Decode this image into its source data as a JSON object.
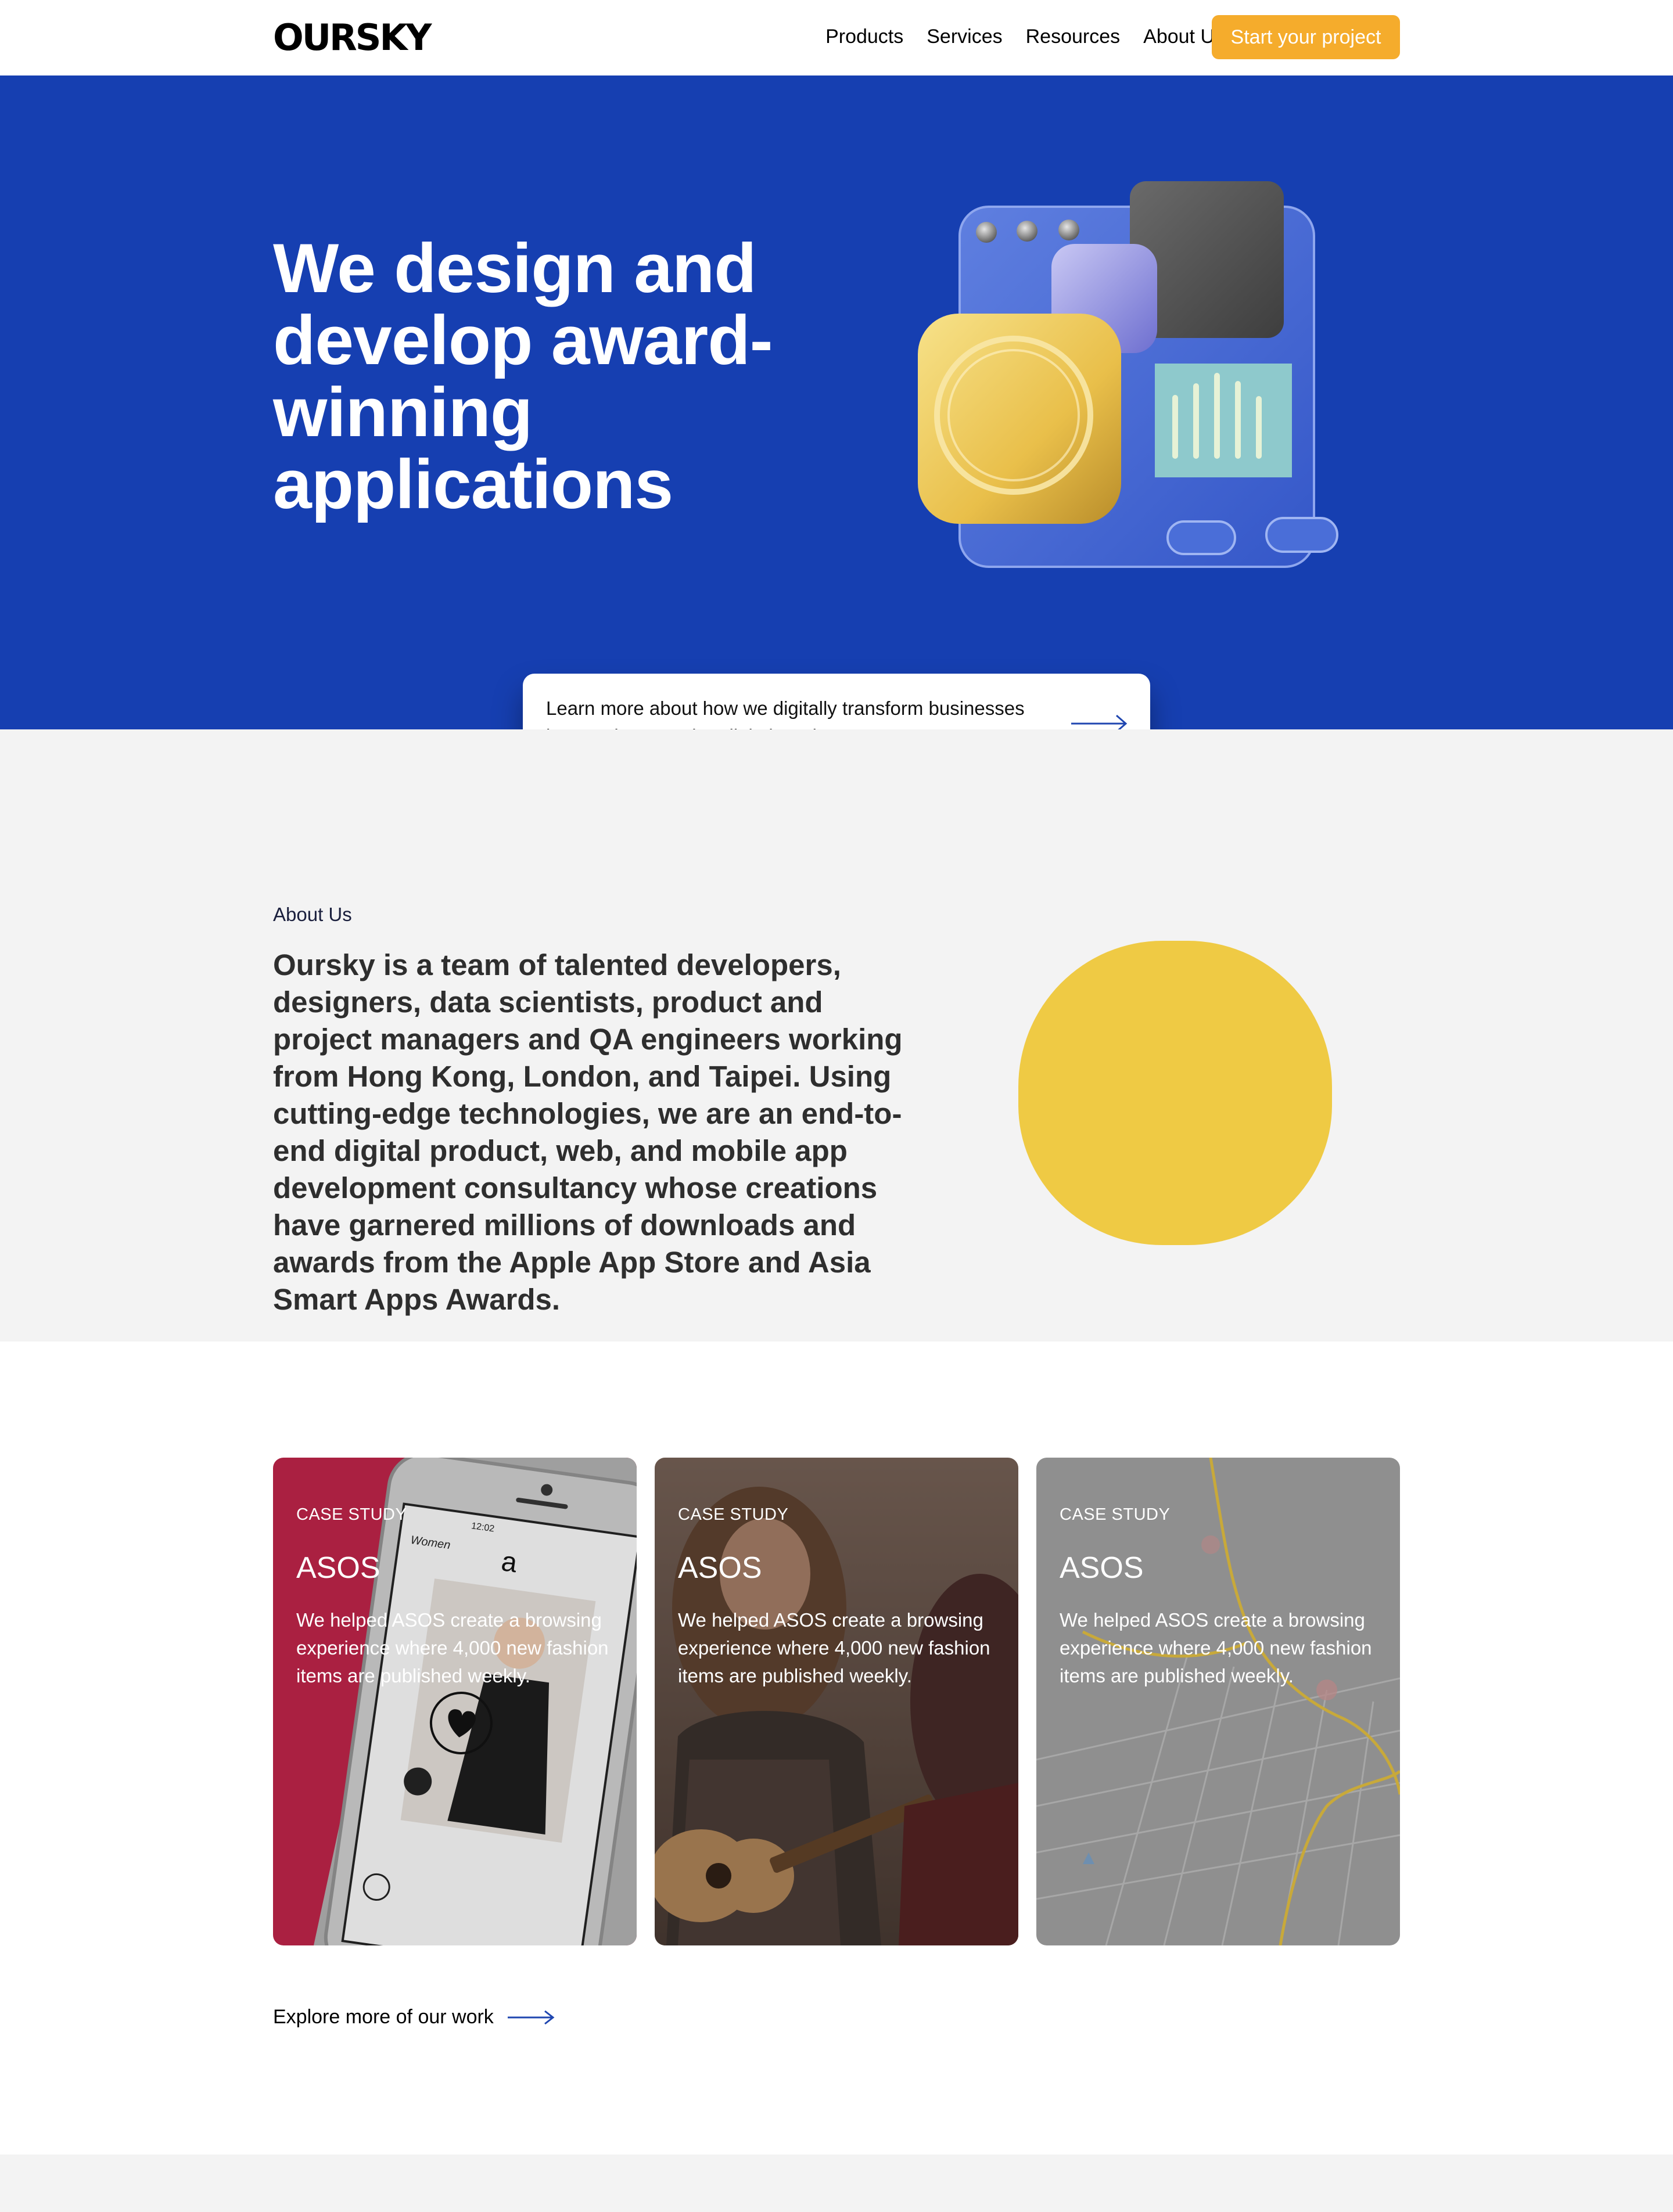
{
  "nav": {
    "logo": "OURSKY",
    "items": [
      {
        "label": "Products"
      },
      {
        "label": "Services"
      },
      {
        "label": "Resources"
      },
      {
        "label": "About Us"
      }
    ],
    "cta": "Start your project"
  },
  "hero": {
    "title": "We design and develop award-winning applications",
    "learn_more": "Learn more about how we digitally transform businesses by creating amazing digital products."
  },
  "about": {
    "label": "About Us",
    "body": "Oursky is a team of talented developers, designers, data scientists, product and project managers and QA engineers working from Hong Kong, London, and Taipei. Using cutting-edge technologies, we are an end-to-end digital product, web, and mobile app development consultancy whose creations have garnered millions of downloads and awards from the Apple App Store and Asia Smart Apps Awards."
  },
  "case_studies": [
    {
      "kicker": "CASE STUDY",
      "title": "ASOS",
      "description": "We helped ASOS create a browsing experience where 4,000 new fashion items are published weekly.",
      "phone": {
        "time": "12:02",
        "brand": "a",
        "section": "Women"
      }
    },
    {
      "kicker": "CASE STUDY",
      "title": "ASOS",
      "description": "We helped ASOS create a browsing experience where 4,000 new fashion items are published weekly."
    },
    {
      "kicker": "CASE STUDY",
      "title": "ASOS",
      "description": "We helped ASOS create a browsing experience where 4,000 new fashion items are published weekly."
    }
  ],
  "explore": "Explore more of our work",
  "colors": {
    "hero_blue": "#163fb1",
    "cta_orange": "#f5ac2c",
    "blob_yellow": "#efca44",
    "card_red": "#b52246",
    "card_brown": "#5e4e46",
    "card_grey": "#8f8f8f",
    "arrow_blue": "#1f46b0"
  }
}
